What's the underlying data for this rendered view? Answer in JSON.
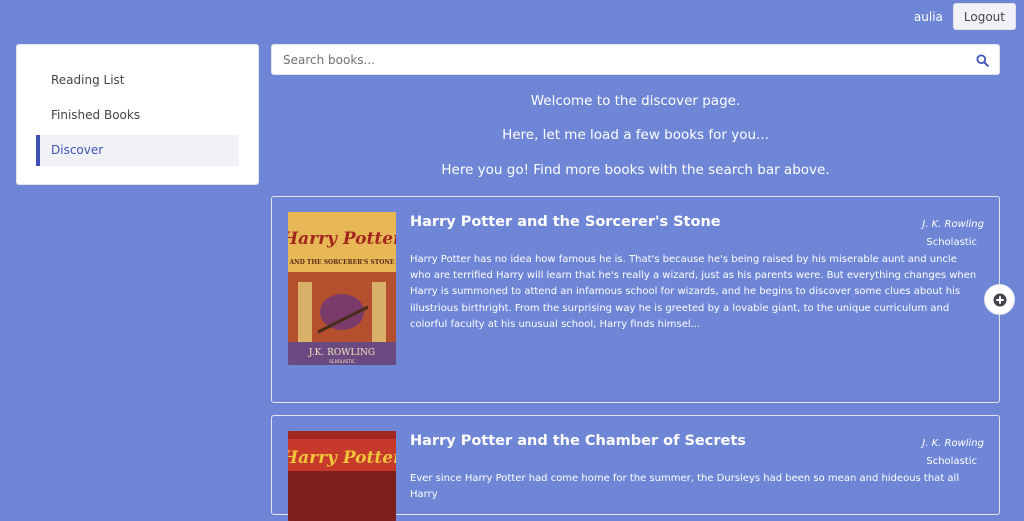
{
  "header": {
    "username": "aulia",
    "logout_label": "Logout"
  },
  "sidebar": {
    "items": [
      {
        "label": "Reading List",
        "active": false
      },
      {
        "label": "Finished Books",
        "active": false
      },
      {
        "label": "Discover",
        "active": true
      }
    ]
  },
  "search": {
    "placeholder": "Search books...",
    "value": ""
  },
  "messages": {
    "welcome": "Welcome to the discover page.",
    "loading": "Here, let me load a few books for you...",
    "found": "Here you go! Find more books with the search bar above."
  },
  "books": [
    {
      "title": "Harry Potter and the Sorcerer's Stone",
      "author": "J. K. Rowling",
      "publisher": "Scholastic",
      "description": "Harry Potter has no idea how famous he is. That's because he's being raised by his miserable aunt and uncle who are terrified Harry will learn that he's really a wizard, just as his parents were. But everything changes when Harry is summoned to attend an infamous school for wizards, and he begins to discover some clues about his illustrious birthright. From the surprising way he is greeted by a lovable giant, to the unique curriculum and colorful faculty at his unusual school, Harry finds himsel...",
      "cover_text": "Harry Potter",
      "cover_subtitle": "AND THE SORCERER'S STONE",
      "cover_author": "J.K. ROWLING",
      "cover_brand": "SCHOLASTIC"
    },
    {
      "title": "Harry Potter and the Chamber of Secrets",
      "author": "J. K. Rowling",
      "publisher": "Scholastic",
      "description": "Ever since Harry Potter had come home for the summer, the Dursleys had been so mean and hideous that all Harry",
      "cover_text": "Harry Potter"
    }
  ],
  "colors": {
    "background": "#6f86d6",
    "accent": "#3f51b5",
    "card_border": "#e3e5ee"
  }
}
